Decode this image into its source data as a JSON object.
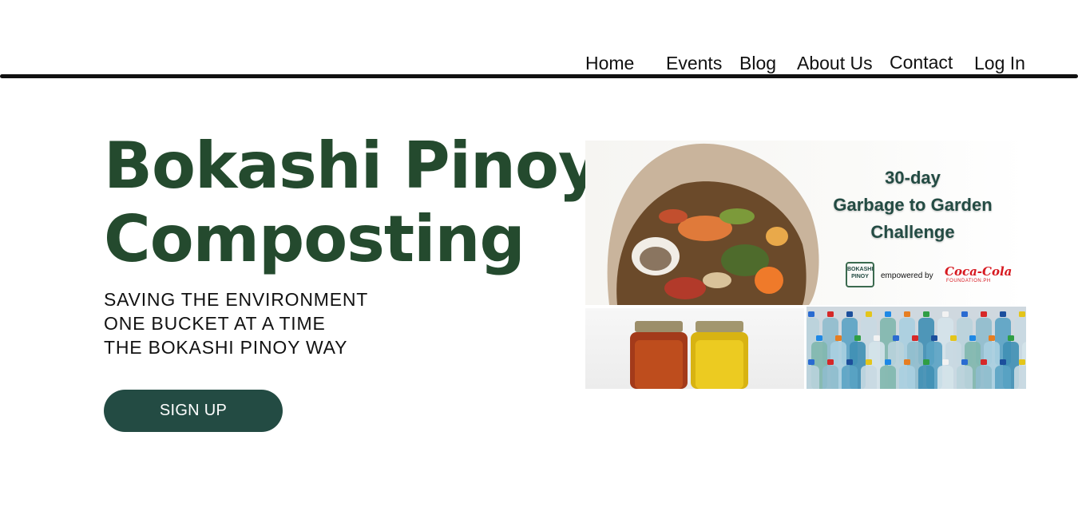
{
  "nav": {
    "items": [
      "Home",
      "Events",
      "Blog",
      "About Us",
      "Contact",
      "Log In"
    ]
  },
  "hero": {
    "title_line1": "Bokashi Pinoy",
    "title_line2": "Composting",
    "tagline": [
      "SAVING THE ENVIRONMENT",
      "ONE BUCKET AT A TIME",
      "THE BOKASHI PINOY WAY"
    ],
    "signup_label": "SIGN UP"
  },
  "banner": {
    "title": [
      "30-day",
      "Garbage to Garden",
      "Challenge"
    ],
    "logo_text": [
      "BOKASHI",
      "PINOY"
    ],
    "empowered_text": "empowered by",
    "sponsor_logo": "Coca-Cola",
    "sponsor_sub": "FOUNDATION.PH"
  },
  "colors": {
    "brand_green": "#244a2e",
    "button_green": "#234b43",
    "sponsor_red": "#d71920"
  },
  "icons": {
    "compost_photo": "compost-bag-photo",
    "jars_photo": "mason-jars-photo",
    "bottles_photo": "plastic-bottles-photo"
  }
}
